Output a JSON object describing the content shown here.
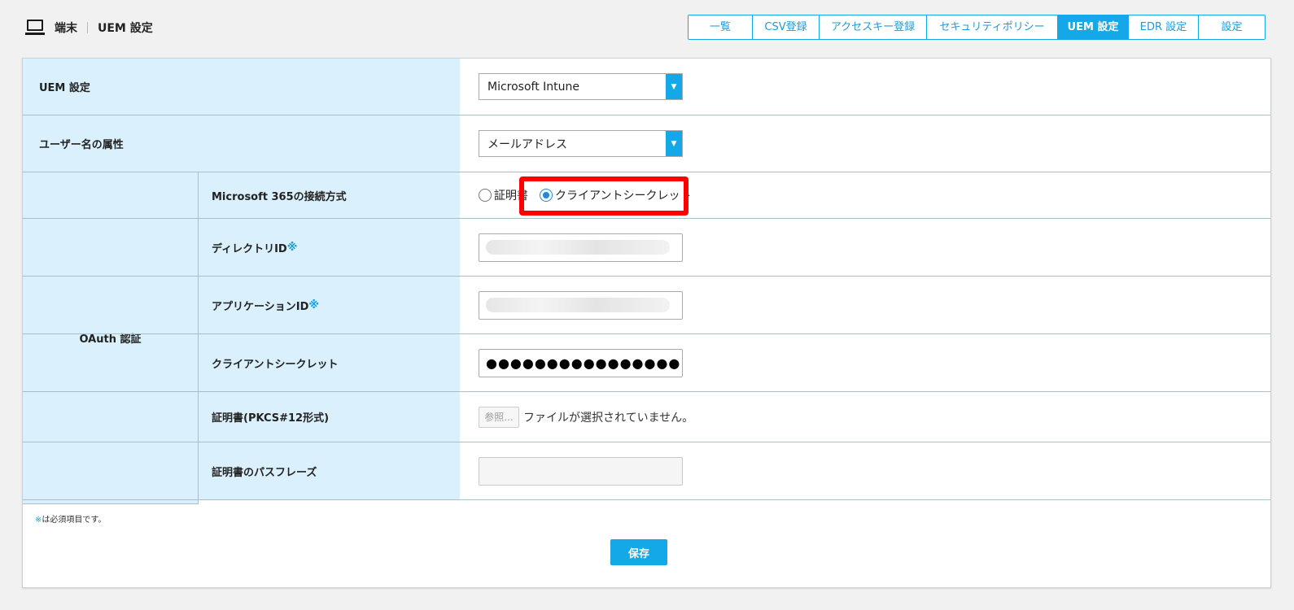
{
  "header": {
    "breadcrumb_root": "端末",
    "breadcrumb_current": "UEM 設定",
    "tabs": [
      "一覧",
      "CSV登録",
      "アクセスキー登録",
      "セキュリティポリシー",
      "UEM 設定",
      "EDR 設定",
      "設定"
    ],
    "active_tab": "UEM 設定"
  },
  "form": {
    "uem_label": "UEM 設定",
    "uem_value": "Microsoft Intune",
    "username_attr_label": "ユーザー名の属性",
    "username_attr_value": "メールアドレス",
    "oauth_label": "OAuth 認証",
    "connection_label": "Microsoft 365の接続方式",
    "connection_options": [
      "証明書",
      "クライアントシークレット"
    ],
    "connection_selected": "クライアントシークレット",
    "directory_id_label": "ディレクトリID",
    "application_id_label": "アプリケーションID",
    "required_mark": "※",
    "client_secret_label": "クライアントシークレット",
    "client_secret_value": "●●●●●●●●●●●●●●●●",
    "cert_label": "証明書(PKCS#12形式)",
    "file_button": "参照...",
    "file_status": "ファイルが選択されていません。",
    "passphrase_label": "証明書のパスフレーズ"
  },
  "footer": {
    "required_note": "は必須項目です。",
    "save_label": "保存"
  },
  "colors": {
    "accent": "#15a8e8",
    "label_bg": "#daf1fd",
    "highlight": "#ff0000"
  }
}
